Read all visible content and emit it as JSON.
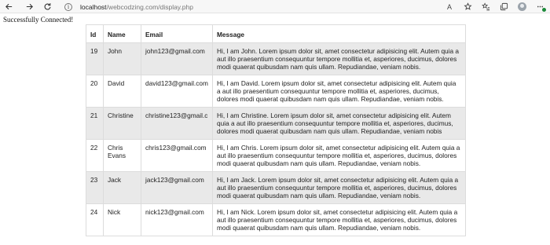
{
  "browser": {
    "url_host": "localhost",
    "url_path": "/webcodzing.com/display.php",
    "info_glyph": "i",
    "reader_glyph": "A",
    "icons": [
      "back-icon",
      "forward-icon",
      "reload-icon",
      "info-icon",
      "read-aloud-icon",
      "favorite-add-icon",
      "favorites-icon",
      "collections-icon",
      "profile-avatar",
      "extension-icon"
    ]
  },
  "page": {
    "status": "Successfully Connected!"
  },
  "table": {
    "headers": {
      "id": "Id",
      "name": "Name",
      "email": "Email",
      "message": "Message"
    },
    "rows": [
      {
        "id": "19",
        "name": "John",
        "email": "john123@gmail.com",
        "message": "Hi, I am John. Lorem ipsum dolor sit, amet consectetur adipisicing elit. Autem quia a aut illo praesentium consequuntur tempore mollitia et, asperiores, ducimus, dolores modi quaerat quibusdam nam quis ullam. Repudiandae, veniam nobis."
      },
      {
        "id": "20",
        "name": "David",
        "email": "david123@gmail.com",
        "message": "Hi, I am David. Lorem ipsum dolor sit, amet consectetur adipisicing elit. Autem quia a aut illo praesentium consequuntur tempore mollitia et, asperiores, ducimus, dolores modi quaerat quibusdam nam quis ullam. Repudiandae, veniam nobis."
      },
      {
        "id": "21",
        "name": "Christine",
        "email": "christine123@gmail.c",
        "message": "Hi, I am Christine. Lorem ipsum dolor sit, amet consectetur adipisicing elit. Autem quia a aut illo praesentium consequuntur tempore mollitia et, asperiores, ducimus, dolores modi quaerat quibusdam nam quis ullam. Repudiandae, veniam nobis"
      },
      {
        "id": "22",
        "name": "Chris Evans",
        "email": "chris123@gmail.com",
        "message": "Hi, I am Chris. Lorem ipsum dolor sit, amet consectetur adipisicing elit. Autem quia a aut illo praesentium consequuntur tempore mollitia et, asperiores, ducimus, dolores modi quaerat quibusdam nam quis ullam. Repudiandae, veniam nobis."
      },
      {
        "id": "23",
        "name": "Jack",
        "email": "jack123@gmail.com",
        "message": "Hi, I am Jack. Lorem ipsum dolor sit, amet consectetur adipisicing elit. Autem quia a aut illo praesentium consequuntur tempore mollitia et, asperiores, ducimus, dolores modi quaerat quibusdam nam quis ullam. Repudiandae, veniam nobis."
      },
      {
        "id": "24",
        "name": "Nick",
        "email": "nick123@gmail.com",
        "message": "Hi, I am Nick. Lorem ipsum dolor sit, amet consectetur adipisicing elit. Autem quia a aut illo praesentium consequuntur tempore mollitia et, asperiores, ducimus, dolores modi quaerat quibusdam nam quis ullam. Repudiandae, veniam nobis."
      }
    ]
  },
  "colors": {
    "shaded_row": "#e9e9e9",
    "border": "#dcdcdc",
    "extension_badge": "#1b8a3a"
  }
}
